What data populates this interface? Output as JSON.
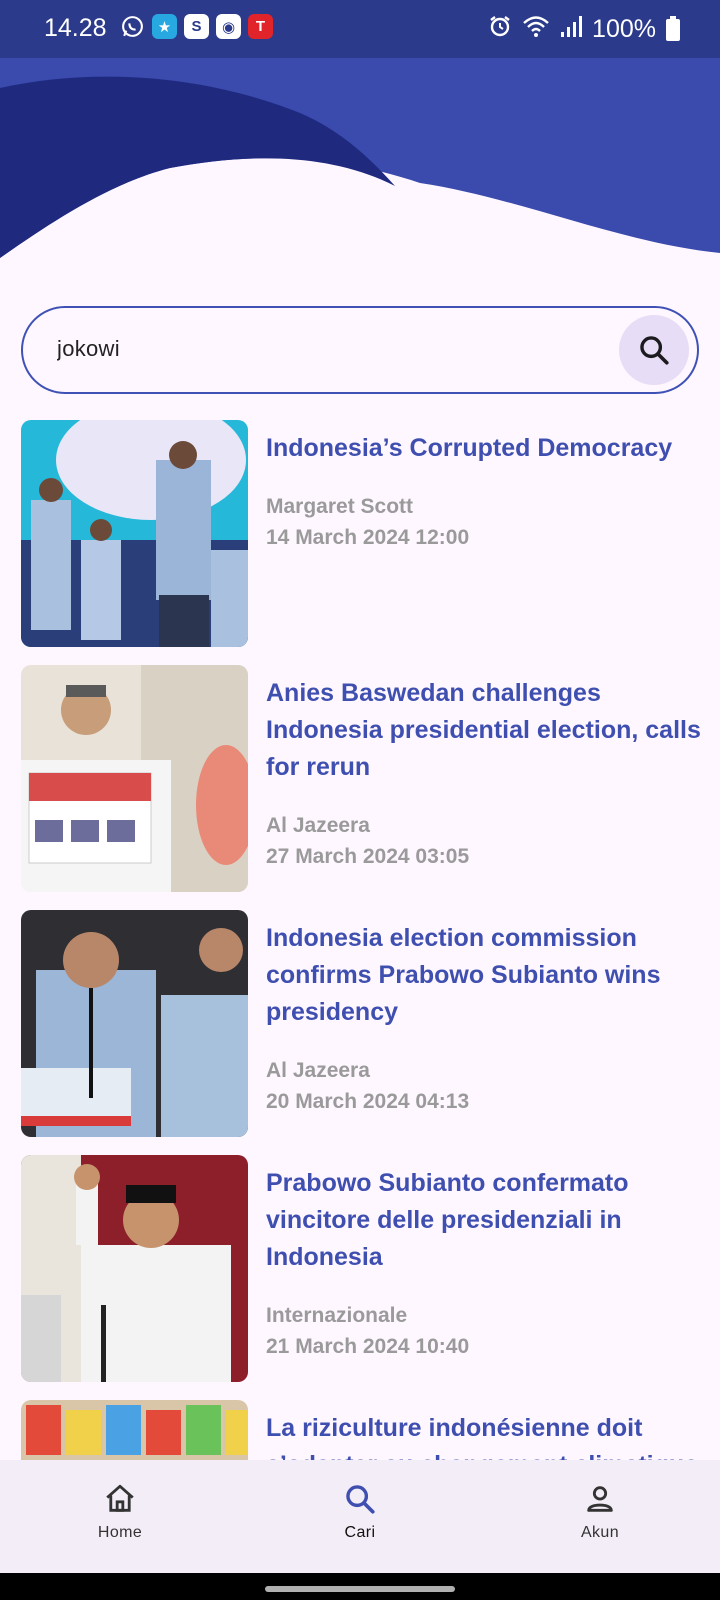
{
  "status_bar": {
    "time": "14.28",
    "battery": "100%",
    "app_icons": [
      "whatsapp-icon",
      "star-app-icon",
      "shopee-icon",
      "game-controller-icon",
      "telkomsel-icon"
    ],
    "system_icons": [
      "alarm-icon",
      "wifi-icon",
      "signal-icon",
      "battery-icon"
    ]
  },
  "colors": {
    "header": "#2b3a8a",
    "wave_light": "#3a4aad",
    "wave_dark": "#1f2a7f",
    "accent": "#3f4fb0",
    "search_button_bg": "#e8ddf6",
    "nav_bg": "#f3edf7"
  },
  "search": {
    "value": "jokowi",
    "placeholder": "",
    "button_icon": "search-icon"
  },
  "articles": [
    {
      "title": "Indonesia’s Corrupted Democracy",
      "source": "Margaret Scott",
      "date": "14 March 2024 12:00"
    },
    {
      "title": "Anies Baswedan challenges Indonesia presidential election, calls for rerun",
      "source": "Al Jazeera",
      "date": "27 March 2024 03:05"
    },
    {
      "title": "Indonesia election commission confirms Prabowo Subianto wins presidency",
      "source": "Al Jazeera",
      "date": "20 March 2024 04:13"
    },
    {
      "title": "Prabowo Subianto confermato vincitore delle presidenziali in Indonesia",
      "source": "Internazionale",
      "date": "21 March 2024 10:40"
    },
    {
      "title": "La riziculture indonésienne doit s’adapter au changement climatique",
      "source": "",
      "date": ""
    }
  ],
  "bottom_nav": {
    "items": [
      {
        "label": "Home",
        "icon": "home-icon"
      },
      {
        "label": "Cari",
        "icon": "search-icon",
        "active": true
      },
      {
        "label": "Akun",
        "icon": "person-icon"
      }
    ]
  }
}
